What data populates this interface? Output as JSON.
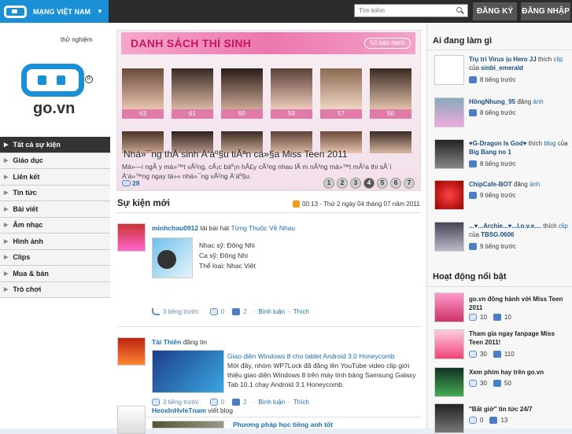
{
  "topbar": {
    "brand": "MẠNG VIỆT NAM",
    "search_placeholder": "Tìm kiếm",
    "register_label": "ĐĂNG KÝ",
    "login_label": "ĐĂNG NHẬP"
  },
  "logo": {
    "beta": "thử nghiệm",
    "text": "go.vn"
  },
  "sidebar": {
    "items": [
      {
        "label": "Tất cả sự kiện"
      },
      {
        "label": "Giáo dục"
      },
      {
        "label": "Liên kết"
      },
      {
        "label": "Tin tức"
      },
      {
        "label": "Bài viết"
      },
      {
        "label": "Âm nhạc"
      },
      {
        "label": "Hình ảnh"
      },
      {
        "label": "Clips"
      },
      {
        "label": "Mua & bán"
      },
      {
        "label": "Trò chơi"
      }
    ]
  },
  "banner": {
    "title": "DANH SÁCH THÍ SINH",
    "more_label": "Số báo danh",
    "contestants": [
      "63",
      "61",
      "60",
      "59",
      "57",
      "56"
    ],
    "caption": "Nhá»¯ng thÃ­ sinh Ä‘áº§u tiÃªn cá»§a Miss Teen 2011",
    "description": "Má»—i ngÃ y má»™t vÃ²ng, cÃ¡c báº¡n hÃ£y cÃ¹ng nhau lÃ m nÃ³ng má»™t mÃ¹a thi sÃ´i Ä‘á»™ng ngay tá»« nhá»¯ng vÃ²ng Ä‘áº§u.",
    "comment_count": "28",
    "pages": [
      "1",
      "2",
      "3",
      "4",
      "5",
      "6",
      "7"
    ],
    "current_page": "4"
  },
  "events": {
    "heading": "Sự kiện mới",
    "date": "00:13 - Thứ 2 ngày 04 tháng 07 năm 2011",
    "posts": [
      {
        "user": "minhchau0912",
        "action": "tải bài hát",
        "target": "Từng Thuộc Về Nhau",
        "lines": [
          "Nhạc sỹ: Đông Nhi",
          "Ca sỹ: Đông Nhi",
          "Thể loại: Nhạc Việt"
        ],
        "time": "3 tiếng trước",
        "comments": "0",
        "likes": "2",
        "comment_label": "Bình luận",
        "like_label": "Thích"
      },
      {
        "user": "Tài Thiên",
        "action": "đăng tin",
        "target": "Giao diện Windows 8 cho tablet Android 3.0 Honeycomb",
        "body": "Mới đây, nhóm WP7Lock đã đăng lên YouTube video clip giới thiệu giao diện Windows 8 trên máy tính bảng Samsung Galaxy Tab 10.1 chạy Android 3.1 Honeycomb.",
        "time": "3 tiếng trước",
        "comments": "0",
        "likes": "2",
        "comment_label": "Bình luận",
        "like_label": "Thích"
      },
      {
        "user": "HeoxInHvleTnam",
        "action": "viết blog",
        "target": "Phương pháp học tiếng anh tốt"
      }
    ]
  },
  "activity": {
    "heading": "Ai đang làm gì",
    "items": [
      {
        "user": "Trụ trì Virus ịu Hero JJ",
        "verb": "thích",
        "what": "clip",
        "of": "của",
        "owner": "sinbi_emerald",
        "time": "8 tiếng trước"
      },
      {
        "user": "HồngNhung_95",
        "verb": "đăng",
        "what": "ảnh",
        "time": "8 tiếng trước"
      },
      {
        "user": "♥G-Dragon Is God♥",
        "verb": "thích",
        "what": "blog",
        "of": "của",
        "owner": "Big Bang no 1",
        "time": "8 tiếng trước"
      },
      {
        "user": "ChipCafe-BOT",
        "verb": "đăng",
        "what": "ảnh",
        "time": "9 tiếng trước"
      },
      {
        "user": "...♥...Archie...♥...l.o.v.e....",
        "verb": "thích",
        "what": "clip",
        "of": "của",
        "owner": "TBSG.0606",
        "time": "9 tiếng trước"
      }
    ]
  },
  "highlights": {
    "heading": "Hoạt động nổi bật",
    "items": [
      {
        "title": "go.vn đồng hành với Miss Teen 2011",
        "comments": "10",
        "likes": "10"
      },
      {
        "title": "Tham gia ngay fanpage Miss Teen 2011!",
        "comments": "30",
        "likes": "110"
      },
      {
        "title": "Xem phim hay trên go.vn",
        "comments": "30",
        "likes": "50"
      },
      {
        "title": "\"Bất giờ\" tin tức 24/7",
        "comments": "0",
        "likes": "13"
      }
    ]
  },
  "colors": {
    "accent": "#1a8fd6",
    "dark": "#2b2b2b",
    "pink": "#ec77af",
    "link": "#1a6fb0"
  }
}
